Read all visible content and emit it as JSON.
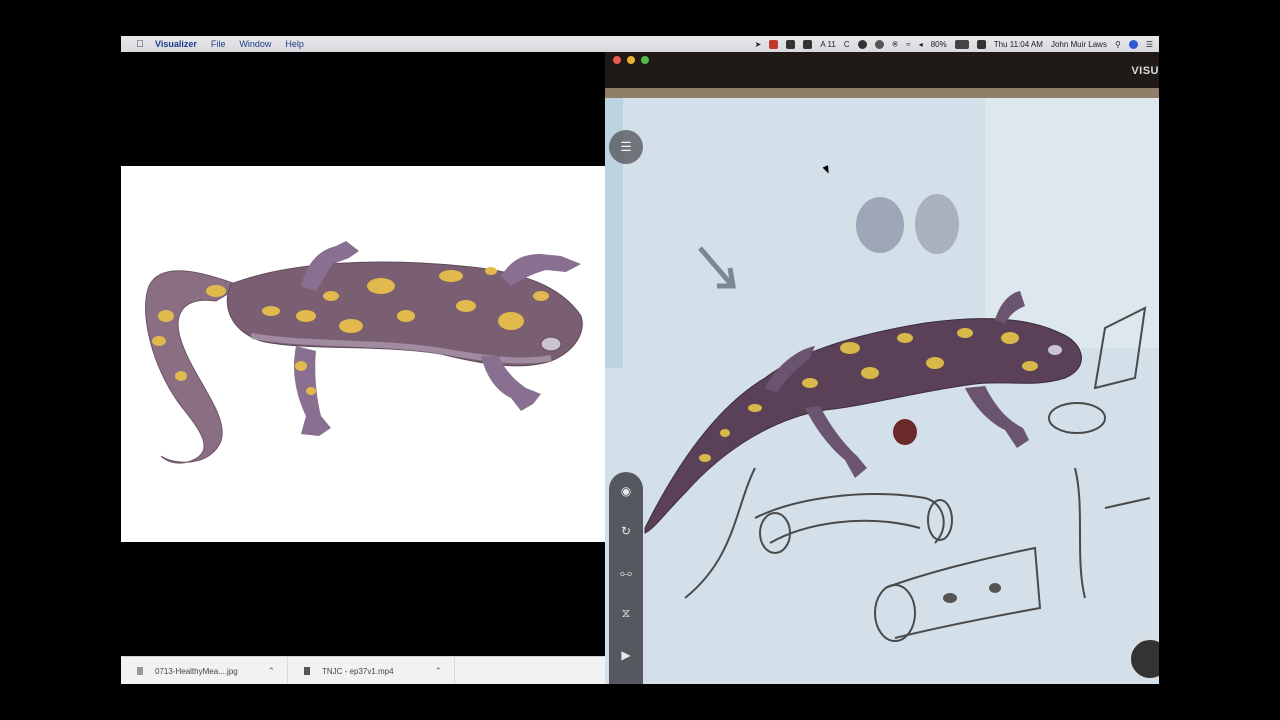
{
  "menubar": {
    "app_name": "Visualizer",
    "menus": [
      "File",
      "Window",
      "Help"
    ],
    "status": {
      "notification_count": "11",
      "battery": "80%",
      "clock": "Thu 11:04 AM",
      "user": "John Muir Laws"
    }
  },
  "downloads": [
    {
      "name": "0713-HealthyMea....jpg"
    },
    {
      "name": "TNJC - ep37v1.mp4"
    }
  ],
  "visualizer": {
    "title": "VISU"
  },
  "icons": {
    "apple": "apple-icon",
    "menu": "list-icon",
    "zoom": "zoom-icon",
    "rotate": "rotate-icon",
    "flip_vertical": "flip-vertical-icon",
    "flip_toggle": "flip-toggle-icon",
    "mirror": "mirror-icon",
    "fit": "fit-screen-icon",
    "record": "record-icon"
  }
}
